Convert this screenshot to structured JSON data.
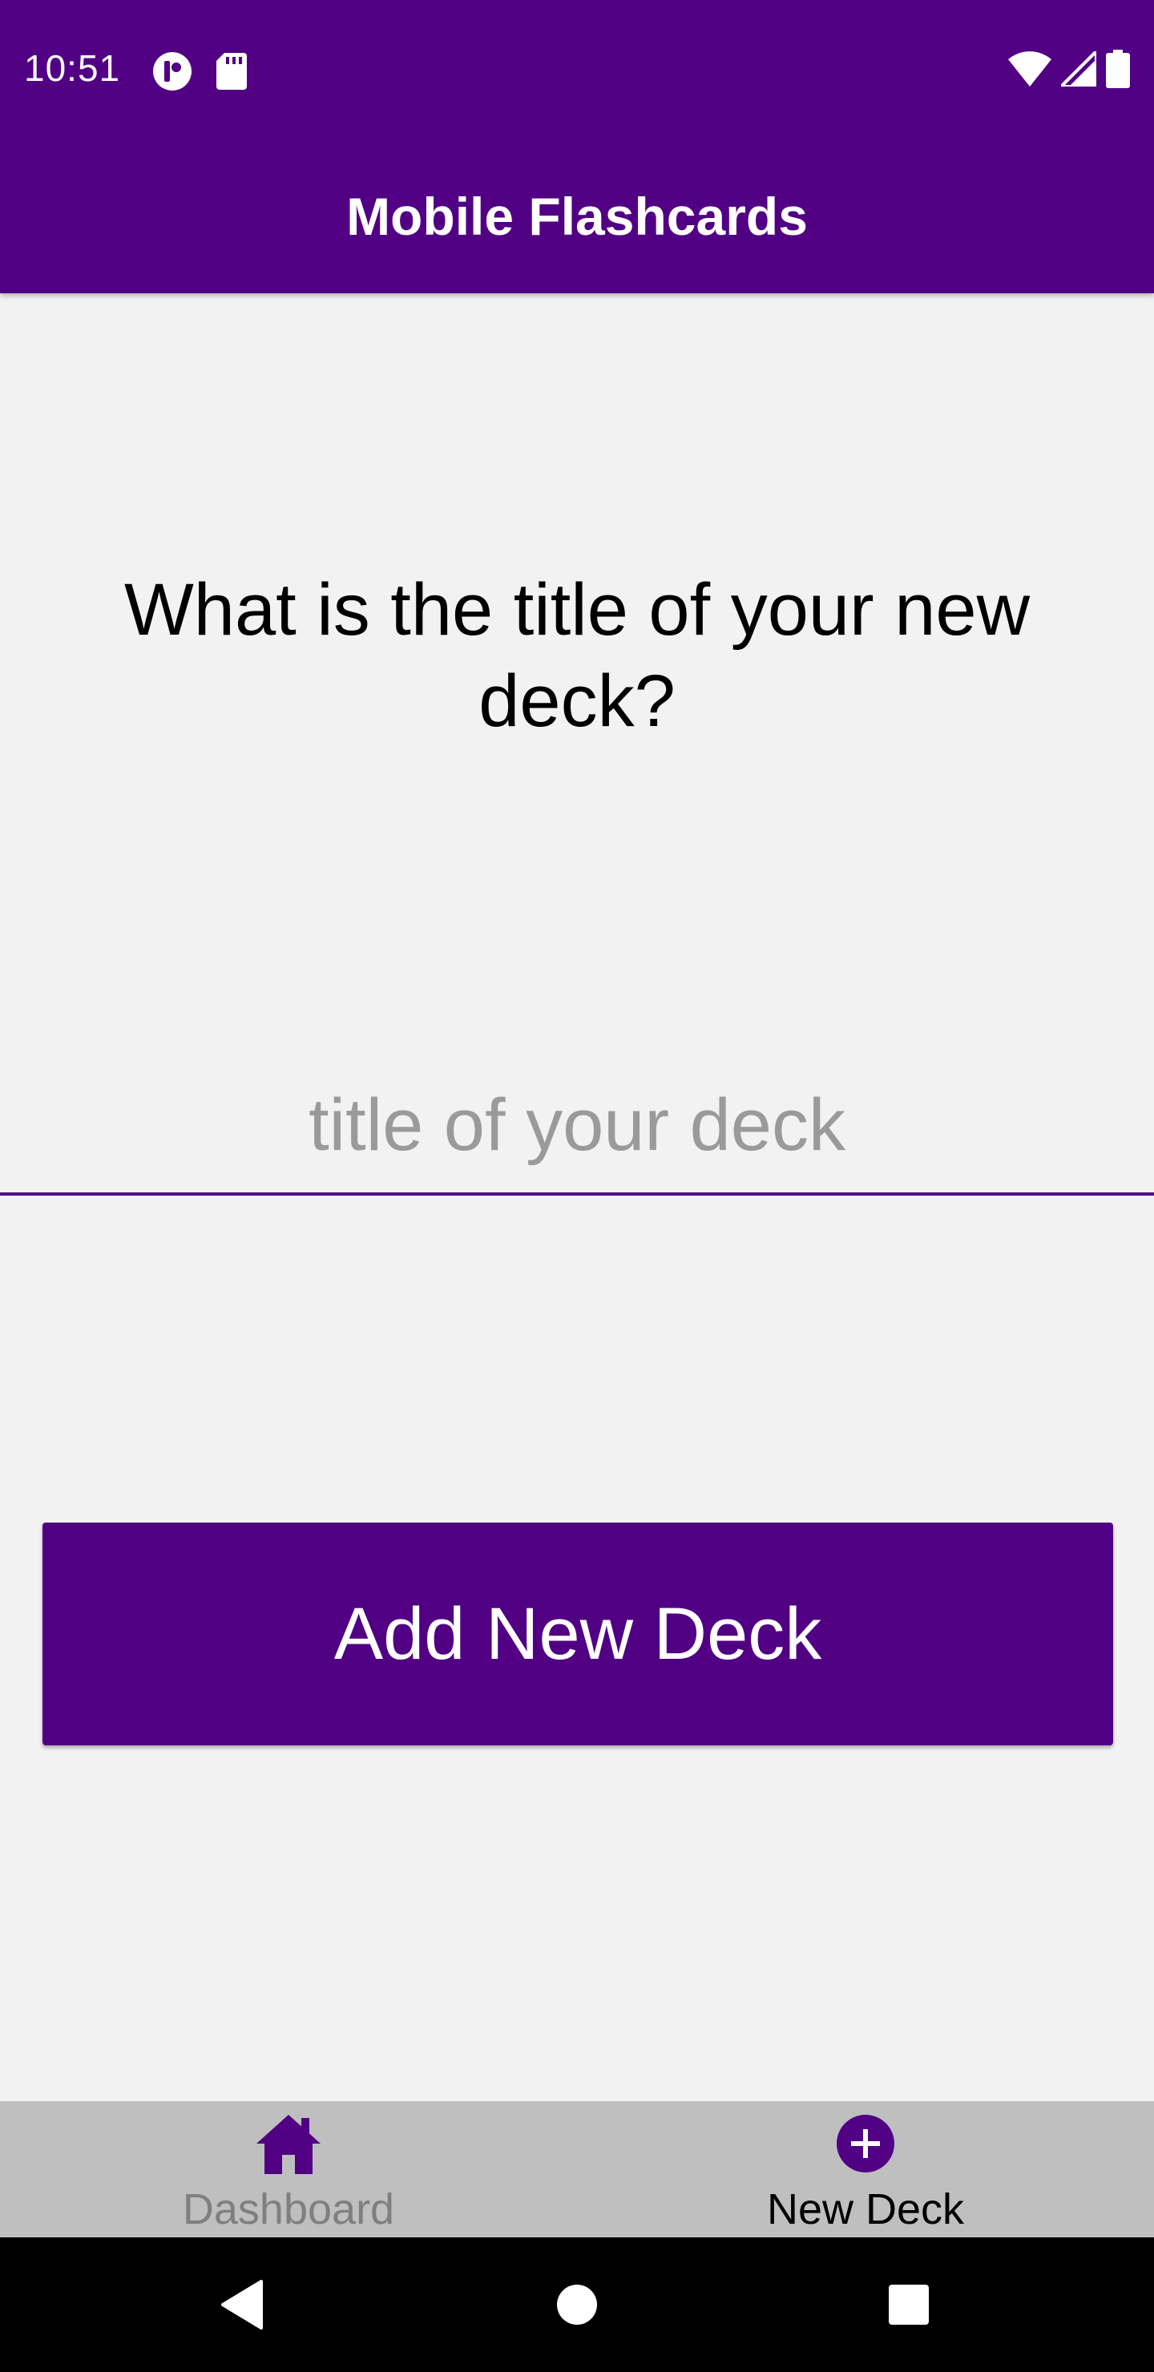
{
  "status_bar": {
    "time": "10:51",
    "left_icons": [
      "circle-app-icon",
      "sd-card-icon"
    ],
    "right_icons": [
      "wifi-icon",
      "signal-icon",
      "battery-icon"
    ]
  },
  "header": {
    "title": "Mobile Flashcards"
  },
  "form": {
    "question": "What is the title of your new deck?",
    "input_value": "",
    "input_placeholder": "title of your deck",
    "submit_label": "Add New Deck"
  },
  "tabs": [
    {
      "label": "Dashboard",
      "icon": "home-icon",
      "active": false
    },
    {
      "label": "New Deck",
      "icon": "plus-circle-icon",
      "active": true
    }
  ],
  "system_nav": [
    "back-icon",
    "home-circle-icon",
    "recents-icon"
  ],
  "colors": {
    "primary": "#510084",
    "background": "#f2f2f2",
    "tab_bar": "#bfbfbf",
    "inactive_label": "#7f7f7f",
    "placeholder": "#9a9a9a"
  }
}
